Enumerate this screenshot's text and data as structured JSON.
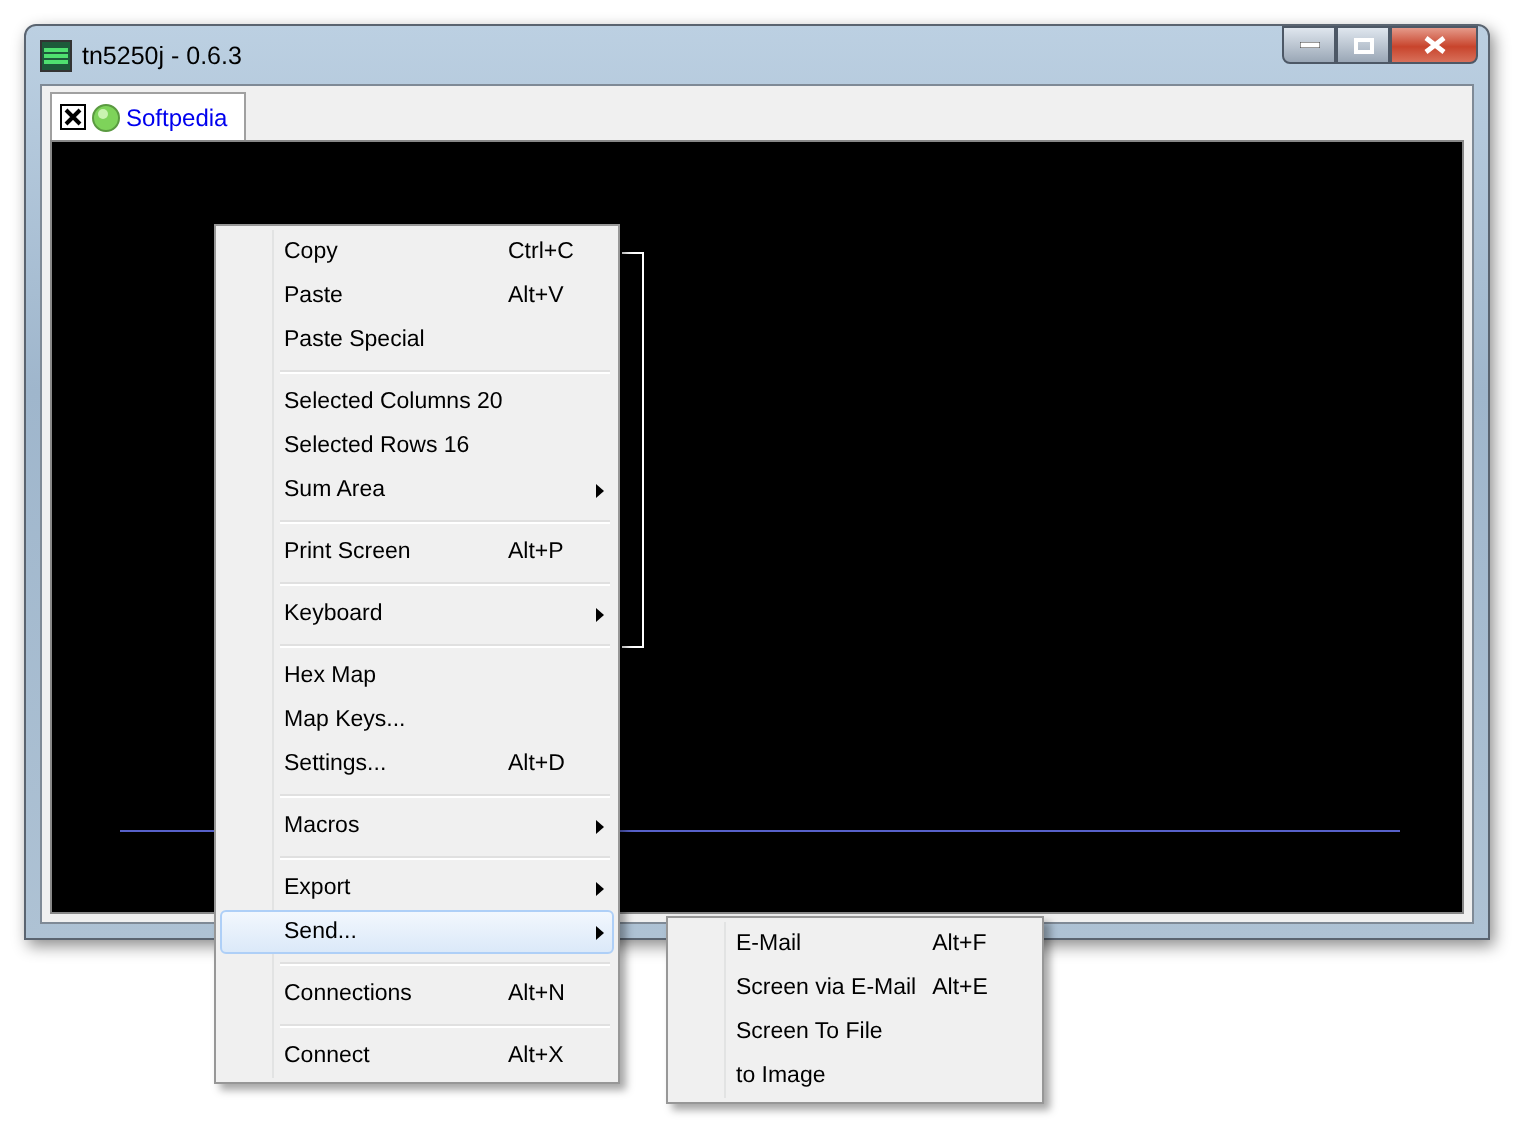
{
  "window": {
    "title": "tn5250j - 0.6.3"
  },
  "tabs": [
    {
      "label": "Softpedia",
      "selected": true
    }
  ],
  "context_menu": {
    "items": [
      {
        "kind": "item",
        "label": "Copy",
        "shortcut": "Ctrl+C",
        "submenu": false,
        "selected": false
      },
      {
        "kind": "item",
        "label": "Paste",
        "shortcut": "Alt+V",
        "submenu": false,
        "selected": false
      },
      {
        "kind": "item",
        "label": "Paste Special",
        "submenu": false,
        "selected": false
      },
      {
        "kind": "separator"
      },
      {
        "kind": "item",
        "label": "Selected Columns 20",
        "submenu": false,
        "selected": false
      },
      {
        "kind": "item",
        "label": "Selected Rows 16",
        "submenu": false,
        "selected": false
      },
      {
        "kind": "item",
        "label": "Sum Area",
        "submenu": true,
        "selected": false
      },
      {
        "kind": "separator"
      },
      {
        "kind": "item",
        "label": "Print Screen",
        "shortcut": "Alt+P",
        "submenu": false,
        "selected": false
      },
      {
        "kind": "separator"
      },
      {
        "kind": "item",
        "label": "Keyboard",
        "submenu": true,
        "selected": false
      },
      {
        "kind": "separator"
      },
      {
        "kind": "item",
        "label": "Hex Map",
        "submenu": false,
        "selected": false
      },
      {
        "kind": "item",
        "label": "Map Keys...",
        "submenu": false,
        "selected": false
      },
      {
        "kind": "item",
        "label": "Settings...",
        "shortcut": "Alt+D",
        "submenu": false,
        "selected": false
      },
      {
        "kind": "separator"
      },
      {
        "kind": "item",
        "label": "Macros",
        "submenu": true,
        "selected": false
      },
      {
        "kind": "separator"
      },
      {
        "kind": "item",
        "label": "Export",
        "submenu": true,
        "selected": false
      },
      {
        "kind": "item",
        "label": "Send...",
        "submenu": true,
        "selected": true
      },
      {
        "kind": "separator"
      },
      {
        "kind": "item",
        "label": "Connections",
        "shortcut": "Alt+N",
        "submenu": false,
        "selected": false
      },
      {
        "kind": "separator"
      },
      {
        "kind": "item",
        "label": "Connect",
        "shortcut": "Alt+X",
        "submenu": false,
        "selected": false
      }
    ]
  },
  "submenu": {
    "items": [
      {
        "kind": "item",
        "label": "E-Mail",
        "shortcut": "Alt+F",
        "submenu": false,
        "selected": false
      },
      {
        "kind": "item",
        "label": "Screen via E-Mail",
        "shortcut": "Alt+E",
        "submenu": false,
        "selected": false
      },
      {
        "kind": "item",
        "label": "Screen To File",
        "submenu": false,
        "selected": false
      },
      {
        "kind": "item",
        "label": "to Image",
        "submenu": false,
        "selected": false
      }
    ]
  }
}
